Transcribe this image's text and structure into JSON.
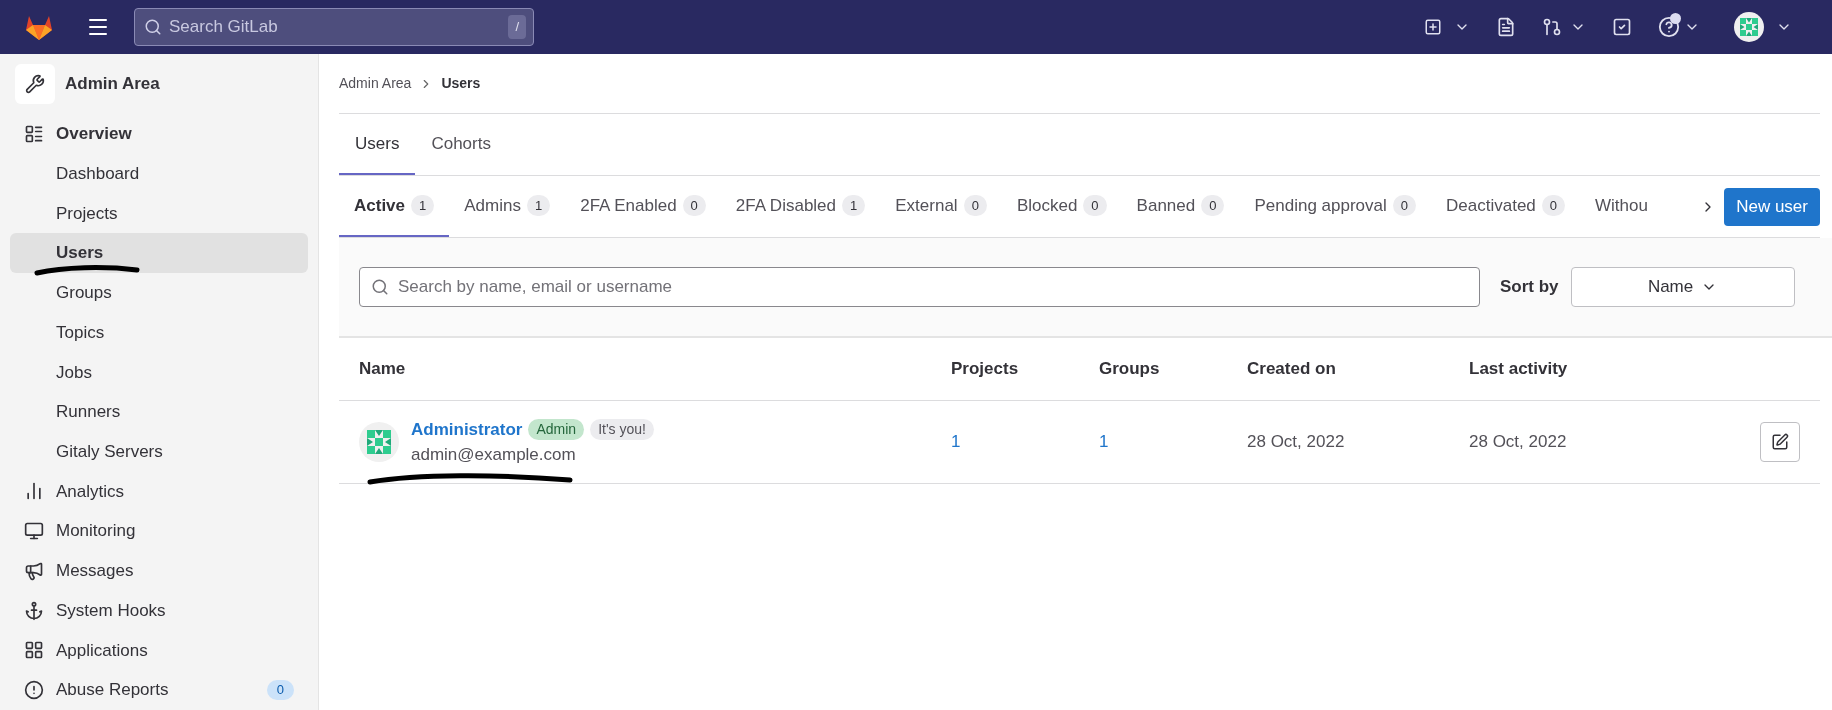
{
  "top_bar": {
    "search": {
      "placeholder": "Search GitLab",
      "shortcut": "/"
    },
    "help_has_notification": true
  },
  "sidebar": {
    "title": "Admin Area",
    "items": [
      {
        "label": "Overview",
        "children": [
          {
            "label": "Dashboard",
            "selected": false
          },
          {
            "label": "Projects",
            "selected": false
          },
          {
            "label": "Users",
            "selected": true
          },
          {
            "label": "Groups",
            "selected": false
          },
          {
            "label": "Topics",
            "selected": false
          },
          {
            "label": "Jobs",
            "selected": false
          },
          {
            "label": "Runners",
            "selected": false
          },
          {
            "label": "Gitaly Servers",
            "selected": false
          }
        ]
      },
      {
        "label": "Analytics"
      },
      {
        "label": "Monitoring"
      },
      {
        "label": "Messages"
      },
      {
        "label": "System Hooks"
      },
      {
        "label": "Applications"
      },
      {
        "label": "Abuse Reports",
        "count": "0"
      }
    ]
  },
  "breadcrumbs": [
    "Admin Area",
    "Users"
  ],
  "tabs": [
    {
      "label": "Users",
      "selected": true
    },
    {
      "label": "Cohorts",
      "selected": false
    }
  ],
  "filter_tabs": [
    {
      "label": "Active",
      "count": "1",
      "selected": true
    },
    {
      "label": "Admins",
      "count": "1",
      "selected": false
    },
    {
      "label": "2FA Enabled",
      "count": "0",
      "selected": false
    },
    {
      "label": "2FA Disabled",
      "count": "1",
      "selected": false
    },
    {
      "label": "External",
      "count": "0",
      "selected": false
    },
    {
      "label": "Blocked",
      "count": "0",
      "selected": false
    },
    {
      "label": "Banned",
      "count": "0",
      "selected": false
    },
    {
      "label": "Pending approval",
      "count": "0",
      "selected": false
    },
    {
      "label": "Deactivated",
      "count": "0",
      "selected": false
    },
    {
      "label": "Withou",
      "selected": false
    }
  ],
  "new_user_button": "New user",
  "search": {
    "placeholder": "Search by name, email or username"
  },
  "sort": {
    "label": "Sort by",
    "value": "Name"
  },
  "table": {
    "columns": [
      "Name",
      "Projects",
      "Groups",
      "Created on",
      "Last activity"
    ],
    "rows": [
      {
        "name": "Administrator",
        "badges": [
          {
            "kind": "admin",
            "label": "Admin"
          },
          {
            "kind": "you",
            "label": "It's you!"
          }
        ],
        "email": "admin@example.com",
        "projects": "1",
        "groups": "1",
        "created_on": "28 Oct, 2022",
        "last_activity": "28 Oct, 2022"
      }
    ]
  }
}
